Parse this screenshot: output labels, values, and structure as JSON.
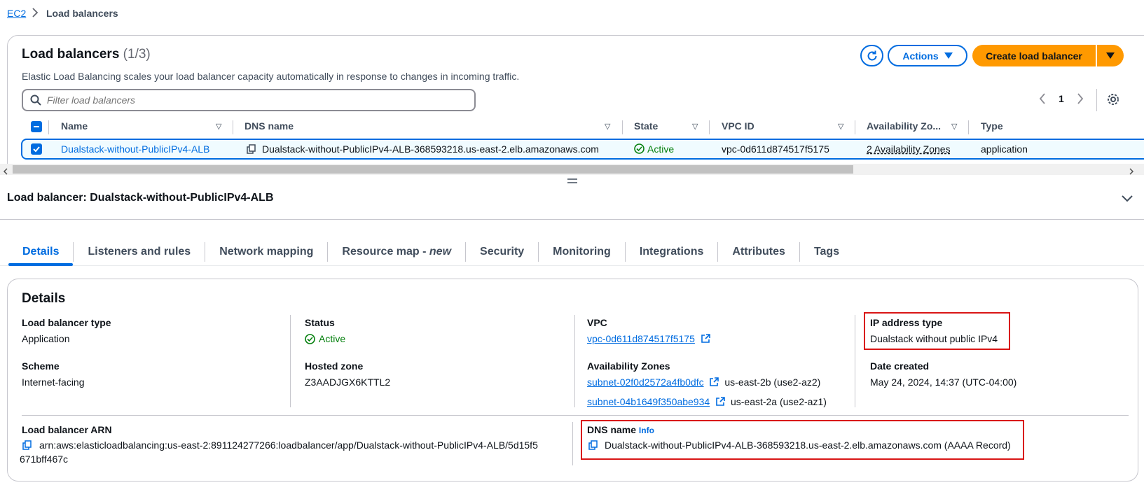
{
  "breadcrumb": {
    "root": "EC2",
    "separator": "›",
    "current": "Load balancers"
  },
  "list": {
    "title": "Load balancers",
    "count": "(1/3)",
    "description": "Elastic Load Balancing scales your load balancer capacity automatically in response to changes in incoming traffic.",
    "actions_label": "Actions",
    "create_label": "Create load balancer",
    "filter_placeholder": "Filter load balancers",
    "page": "1",
    "columns": [
      "Name",
      "DNS name",
      "State",
      "VPC ID",
      "Availability Zo...",
      "Type"
    ],
    "row": {
      "name": "Dualstack-without-PublicIPv4-ALB",
      "dns": "Dualstack-without-PublicIPv4-ALB-368593218.us-east-2.elb.amazonaws.com",
      "state": "Active",
      "vpc": "vpc-0d611d874517f5175",
      "az": "2 Availability Zones",
      "type": "application"
    }
  },
  "detail": {
    "header": "Load balancer: Dualstack-without-PublicIPv4-ALB",
    "tabs": [
      "Details",
      "Listeners and rules",
      "Network mapping",
      "Resource map - ",
      "Security",
      "Monitoring",
      "Integrations",
      "Attributes",
      "Tags"
    ],
    "tab_new": "new",
    "section_title": "Details",
    "lb_type_label": "Load balancer type",
    "lb_type_value": "Application",
    "status_label": "Status",
    "status_value": "Active",
    "vpc_label": "VPC",
    "vpc_value": "vpc-0d611d874517f5175",
    "ip_type_label": "IP address type",
    "ip_type_value": "Dualstack without public IPv4",
    "scheme_label": "Scheme",
    "scheme_value": "Internet-facing",
    "hosted_zone_label": "Hosted zone",
    "hosted_zone_value": "Z3AADJGX6KTTL2",
    "az_label": "Availability Zones",
    "subnet1": "subnet-02f0d2572a4fb0dfc",
    "subnet1_zone": "us-east-2b (use2-az2)",
    "subnet2": "subnet-04b1649f350abe934",
    "subnet2_zone": "us-east-2a (use2-az1)",
    "date_label": "Date created",
    "date_value": "May 24, 2024, 14:37 (UTC-04:00)",
    "arn_label": "Load balancer ARN",
    "arn_line1": "arn:aws:elasticloadbalancing:us-east-2:891124277266:loadbalancer/app/Dualstack-without-PublicIPv4-ALB/5d15f5",
    "arn_line2": "671bff467c",
    "dns_label": "DNS name",
    "dns_info": "Info",
    "dns_value": "Dualstack-without-PublicIPv4-ALB-368593218.us-east-2.elb.amazonaws.com (AAAA Record)"
  },
  "colors": {
    "primary": "#006ce0",
    "accent": "#ff9900",
    "success": "#037f0c",
    "highlight": "#d91515"
  }
}
